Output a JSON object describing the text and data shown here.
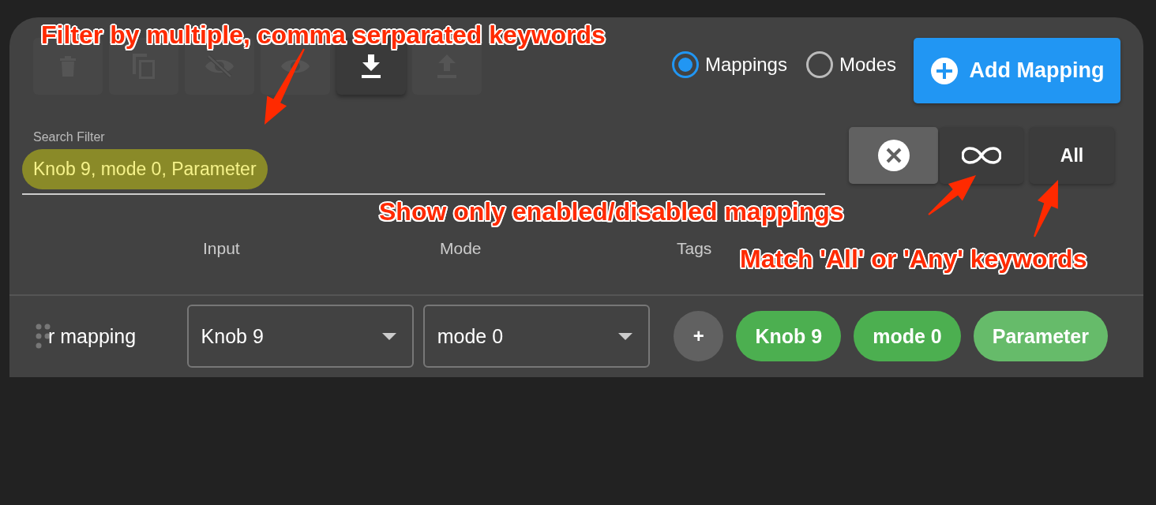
{
  "toolbar": [
    {
      "disabled": true
    },
    {
      "disabled": true
    },
    {
      "disabled": true
    },
    {
      "disabled": true
    },
    {
      "disabled": false
    },
    {
      "disabled": true
    }
  ],
  "view": [
    {
      "label": "Mappings",
      "selected": true
    },
    {
      "label": "Modes",
      "selected": false
    }
  ],
  "add_button": "Add Mapping",
  "search": {
    "label": "Search Filter",
    "value": "Knob 9, mode 0, Parameter",
    "highlighted": true
  },
  "filter_buttons": [
    {
      "kind": "clear",
      "active": true
    },
    {
      "kind": "state",
      "active": false
    },
    {
      "kind": "match",
      "label": "All",
      "active": false
    }
  ],
  "columns": [
    "Input",
    "Mode",
    "Tags"
  ],
  "add_tag": "+",
  "row": {
    "name": "r mapping",
    "input": "Knob 9",
    "mode": "mode 0",
    "tags": [
      {
        "label": "Knob 9",
        "color": "#4caf50"
      },
      {
        "label": "mode 0",
        "color": "#4caf50"
      },
      {
        "label": "Parameter",
        "color": "#66bb6a"
      }
    ]
  },
  "annotations": [
    {
      "text": "Filter by multiple, comma serparated keywords"
    },
    {
      "text": "Show only enabled/disabled mappings"
    },
    {
      "text": "Match 'All' or 'Any' keywords"
    }
  ]
}
